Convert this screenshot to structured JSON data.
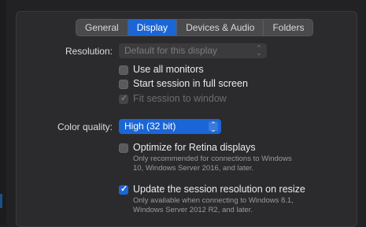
{
  "tabs": [
    {
      "label": "General",
      "active": false
    },
    {
      "label": "Display",
      "active": true
    },
    {
      "label": "Devices & Audio",
      "active": false
    },
    {
      "label": "Folders",
      "active": false
    }
  ],
  "resolution": {
    "label": "Resolution:",
    "value": "Default for this display",
    "enabled": false
  },
  "options": {
    "use_all_monitors": {
      "label": "Use all monitors",
      "checked": false
    },
    "fullscreen": {
      "label": "Start session in full screen",
      "checked": false
    },
    "fit_window": {
      "label": "Fit session to window",
      "checked": true,
      "enabled": false
    }
  },
  "color_quality": {
    "label": "Color quality:",
    "value": "High (32 bit)"
  },
  "retina": {
    "label": "Optimize for Retina displays",
    "checked": false,
    "note_line1": "Only recommended for connections to Windows",
    "note_line2": "10, Windows Server 2016, and later."
  },
  "resize": {
    "label": "Update the session resolution on resize",
    "checked": true,
    "note_line1": "Only available when connecting to Windows 8.1,",
    "note_line2": "Windows Server 2012 R2, and later."
  },
  "colors": {
    "accent": "#1b66d6",
    "background": "#2b2b2d"
  }
}
